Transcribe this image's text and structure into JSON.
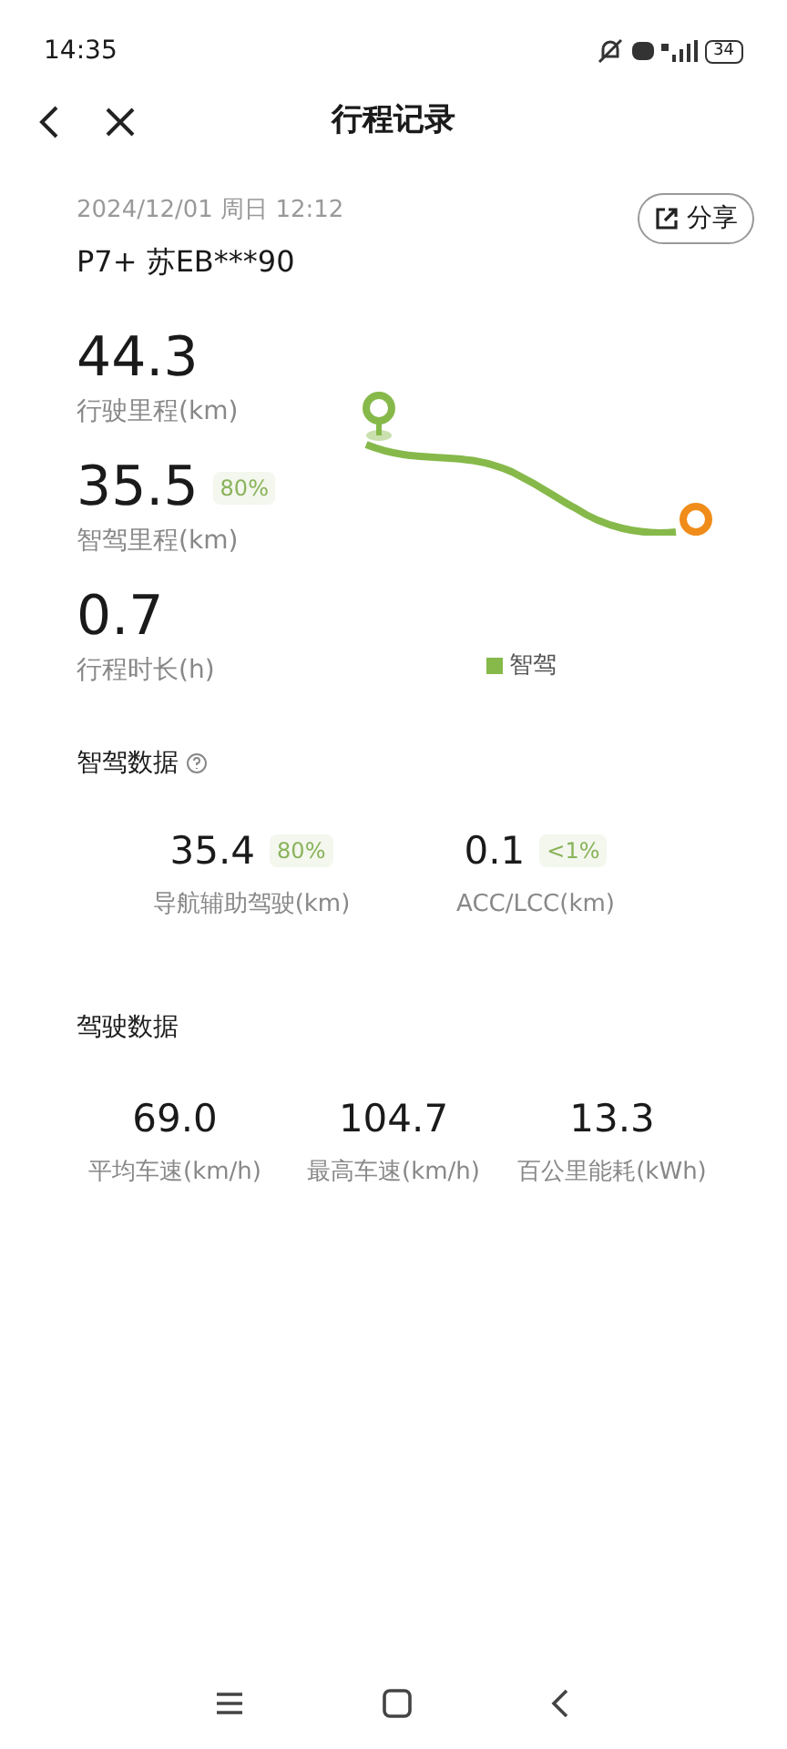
{
  "status_bar": {
    "time": "14:35",
    "battery": "34"
  },
  "header": {
    "title": "行程记录"
  },
  "trip": {
    "datetime": "2024/12/01 周日 12:12",
    "vehicle": "P7+ 苏EB***90",
    "share": "分享"
  },
  "summary": [
    {
      "value": "44.3",
      "label": "行驶里程(km)"
    },
    {
      "value": "35.5",
      "badge": "80%",
      "label": "智驾里程(km)"
    },
    {
      "value": "0.7",
      "label": "行程时长(h)"
    }
  ],
  "legend": [
    {
      "label": "智驾",
      "color": "#86b94a"
    }
  ],
  "smart_driving": {
    "title": "智驾数据",
    "items": [
      {
        "value": "35.4",
        "badge": "80%",
        "label": "导航辅助驾驶(km)"
      },
      {
        "value": "0.1",
        "badge": "<1%",
        "label": "ACC/LCC(km)"
      }
    ]
  },
  "driving": {
    "title": "驾驶数据",
    "items": [
      {
        "value": "69.0",
        "label": "平均车速(km/h)"
      },
      {
        "value": "104.7",
        "label": "最高车速(km/h)"
      },
      {
        "value": "13.3",
        "label": "百公里能耗(kWh)"
      }
    ]
  }
}
